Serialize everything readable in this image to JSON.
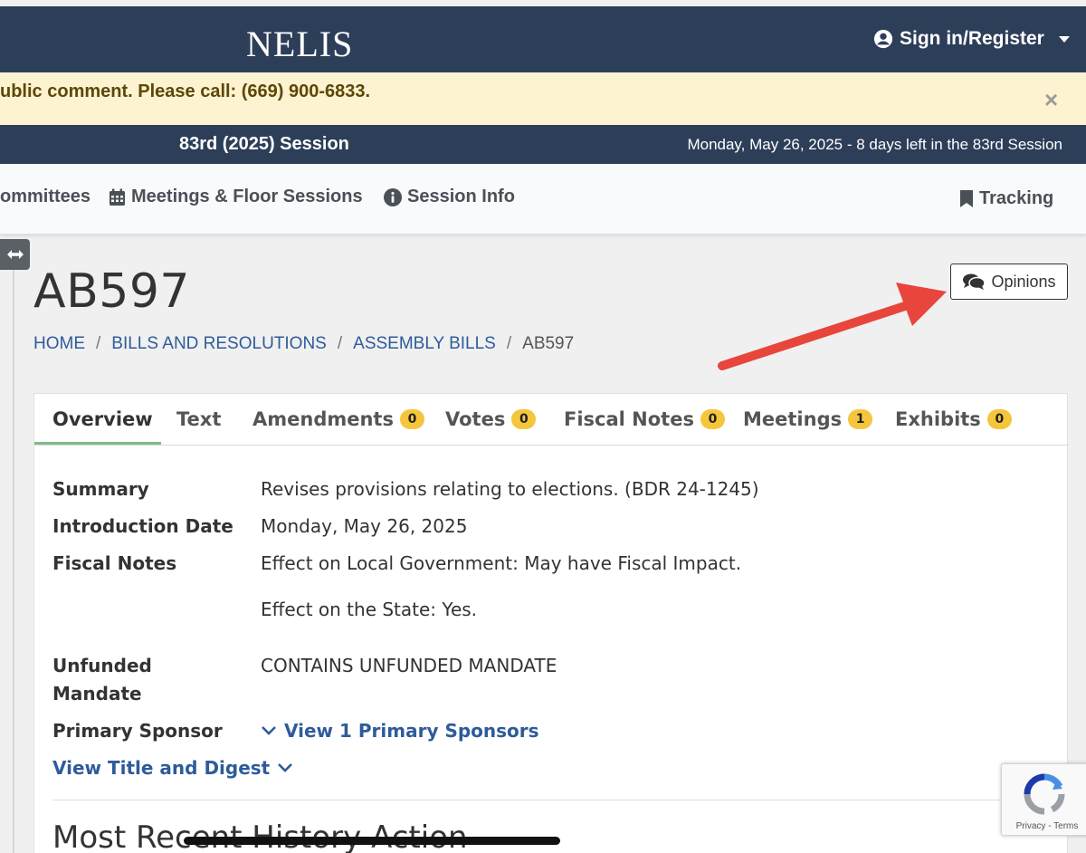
{
  "header": {
    "logo": "NELIS",
    "signin_label": "Sign in/Register"
  },
  "alert": {
    "text": "ublic comment. Please call: (669) 900-6833.",
    "close_glyph": "×"
  },
  "session": {
    "name": "83rd (2025) Session",
    "date_text": "Monday, May 26, 2025 - 8 days left in the 83rd Session"
  },
  "nav": {
    "committees": "ommittees",
    "meetings": "Meetings & Floor Sessions",
    "session_info": "Session Info",
    "tracking": "Tracking"
  },
  "page": {
    "title": "AB597",
    "opinions_label": "Opinions"
  },
  "breadcrumb": {
    "home": "HOME",
    "bills": "BILLS AND RESOLUTIONS",
    "assembly": "ASSEMBLY BILLS",
    "current": "AB597",
    "separator": "/"
  },
  "tabs": [
    {
      "label": "Overview"
    },
    {
      "label": "Text"
    },
    {
      "label": "Amendments",
      "count": "0"
    },
    {
      "label": "Votes",
      "count": "0"
    },
    {
      "label": "Fiscal Notes",
      "count": "0"
    },
    {
      "label": "Meetings",
      "count": "1"
    },
    {
      "label": "Exhibits",
      "count": "0"
    }
  ],
  "overview": {
    "summary_label": "Summary",
    "summary_value": "Revises provisions relating to elections. (BDR 24-1245)",
    "intro_label": "Introduction Date",
    "intro_value": "Monday, May 26, 2025",
    "fiscal_label": "Fiscal Notes",
    "fiscal_local": "Effect on Local Government: May have Fiscal Impact.",
    "fiscal_state": "Effect on the State: Yes.",
    "unfunded_label_1": "Unfunded",
    "unfunded_label_2": "Mandate",
    "unfunded_value": "CONTAINS UNFUNDED MANDATE",
    "sponsor_label": "Primary Sponsor",
    "sponsor_link": "View 1 Primary Sponsors",
    "title_digest_link": "View Title and Digest",
    "history_heading": "Most Recent History Action"
  },
  "recaptcha": {
    "footer": "Privacy - Terms"
  },
  "colors": {
    "navy": "#2d3e59",
    "alert_bg": "#fdf3d0",
    "link": "#2e5b9a",
    "badge": "#f5c63c",
    "active_tab": "#7dbd85",
    "annotation_arrow": "#e8453c"
  }
}
